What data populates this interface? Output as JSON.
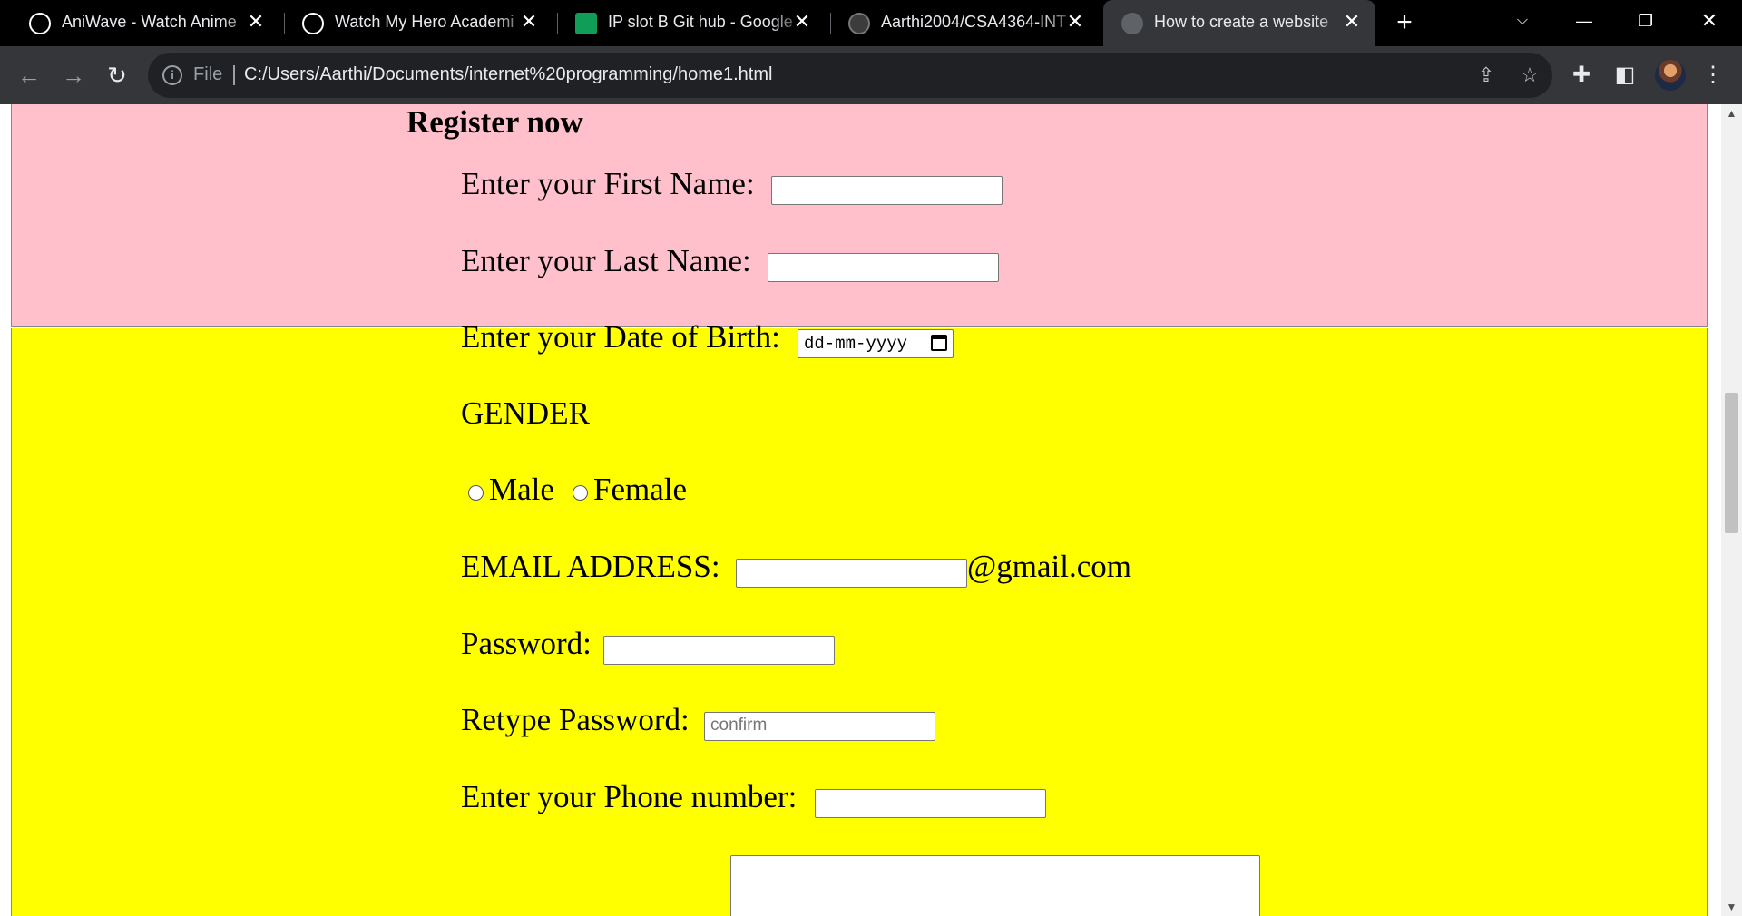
{
  "browser": {
    "tabs": [
      {
        "title": "AniWave - Watch Anime",
        "icon": "aniwave-logo-icon",
        "active": false
      },
      {
        "title": "Watch My Hero Academi",
        "icon": "aniwave-logo-icon",
        "active": false
      },
      {
        "title": "IP slot B Git hub - Google",
        "icon": "google-sheets-icon",
        "active": false
      },
      {
        "title": "Aarthi2004/CSA4364-INT",
        "icon": "github-icon",
        "active": false
      },
      {
        "title": "How to create a website",
        "icon": "globe-icon",
        "active": true
      }
    ],
    "address_prefix": "File",
    "address_url": "C:/Users/Aarthi/Documents/internet%20programming/home1.html"
  },
  "page": {
    "heading": "Register now",
    "first_name_label": "Enter your First Name:",
    "last_name_label": "Enter your Last Name:",
    "dob_label": "Enter your Date of Birth:",
    "dob_format": "dd-mm-yyyy",
    "gender_label": "GENDER",
    "gender_options": [
      "Male",
      "Female"
    ],
    "email_label": "EMAIL ADDRESS:",
    "email_suffix": "@gmail.com",
    "password_label": "Password:",
    "retype_label": "Retype Password:",
    "retype_placeholder": "confirm",
    "phone_label": "Enter your Phone number:"
  },
  "colors": {
    "top_band": "#ffc0cb",
    "bottom_band": "#ffff00"
  }
}
